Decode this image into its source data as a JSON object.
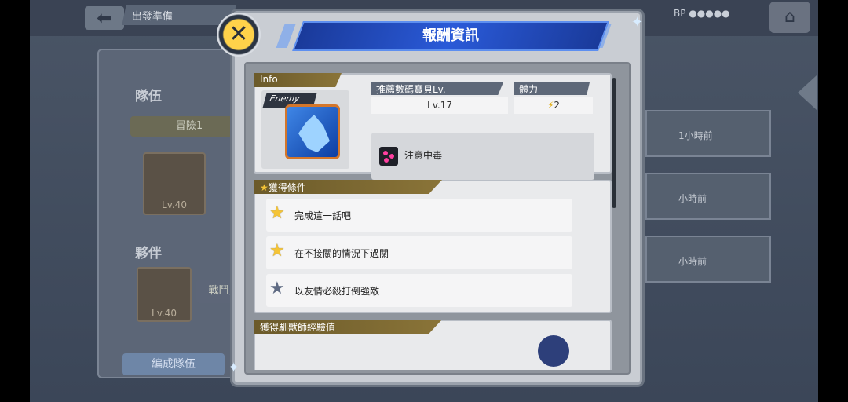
{
  "background": {
    "top_title": "出發準備",
    "team_label": "隊伍",
    "team_tab": "冒險1",
    "partner_label": "夥伴",
    "battle_chip": "戰鬥員",
    "form_team_button": "編成隊伍",
    "card_level_1": "Lv.40",
    "card_level_2": "Lv.40",
    "mission_time_1": "1小時前",
    "mission_time_2": "小時前",
    "mission_time_3": "小時前",
    "bp_label": "BP"
  },
  "modal": {
    "title": "報酬資訊",
    "close_icon": "close-x-icon",
    "info": {
      "tag": "Info",
      "enemy_tag": "Enemy",
      "recommend_label": "推薦數碼寶貝Lv.",
      "recommend_value": "Lv.17",
      "stamina_label": "體力",
      "stamina_value": "2",
      "warning_text": "注意中毒"
    },
    "conditions": {
      "tag": "獲得條件",
      "items": [
        {
          "label": "完成這一話吧",
          "icon": "gold-star"
        },
        {
          "label": "在不接關的情況下過關",
          "icon": "gold-star"
        },
        {
          "label": "以友情必殺打倒強敵",
          "icon": "grey-star"
        }
      ]
    },
    "exp": {
      "tag": "獲得馴獸師經驗值"
    }
  }
}
